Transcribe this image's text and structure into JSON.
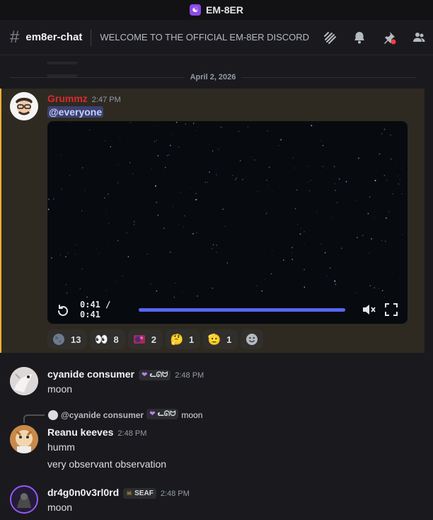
{
  "window": {
    "title": "EM-8ER"
  },
  "header": {
    "channel": "em8er-chat",
    "topic": "WELCOME TO THE OFFICIAL EM-8ER DISCORD ...",
    "icons": [
      "threads-icon",
      "bell-icon",
      "pin-icon",
      "members-icon"
    ]
  },
  "date_divider": "April 2, 2026",
  "messages": [
    {
      "username": "Grummz",
      "username_color": "#d92b2b",
      "time": "2:47 PM",
      "text": "@everyone",
      "video": {
        "time_label": "0:41 / 0:41",
        "progress": 1.0
      },
      "reactions": [
        {
          "emoji": "custom-moon-icon",
          "count": "13"
        },
        {
          "emoji": "👀",
          "count": "8"
        },
        {
          "emoji": "custom-sticker-icon",
          "count": "2"
        },
        {
          "emoji": "🤔",
          "count": "1"
        },
        {
          "emoji": "🫡",
          "count": "1"
        }
      ]
    },
    {
      "username": "cyanide consumer",
      "tag": "ᓚᘏᗢ",
      "time": "2:48 PM",
      "text": "moon"
    },
    {
      "reply_to": {
        "username": "@cyanide consumer",
        "tag": "ᓚᘏᗢ",
        "text": "moon"
      },
      "username": "Reanu keeves",
      "time": "2:48 PM",
      "lines": [
        "humm",
        "very observant observation"
      ]
    },
    {
      "username": "dr4g0n0v3rl0rd",
      "tag": "SEAF",
      "time": "2:48 PM",
      "text": "moon"
    }
  ],
  "colors": {
    "accent": "#5865f2",
    "highlight_border": "#f0b232",
    "highlight_bg": "#2e2a22"
  }
}
